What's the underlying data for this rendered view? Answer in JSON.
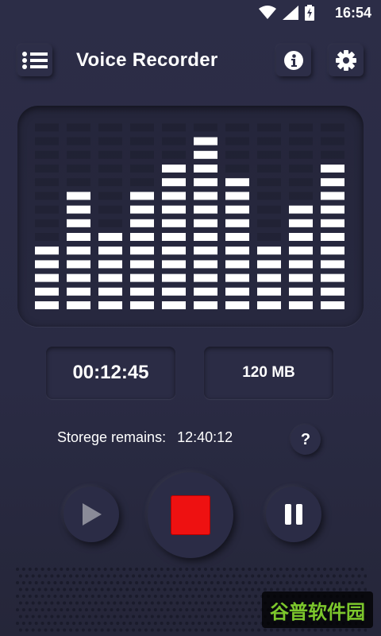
{
  "status_bar": {
    "time": "16:54",
    "icons": [
      "wifi-icon",
      "signal-icon",
      "battery-charging-icon"
    ]
  },
  "app_bar": {
    "title": "Voice Recorder",
    "left_icon": "list-menu-icon",
    "right_icons": [
      "info-icon",
      "gear-icon"
    ]
  },
  "equalizer": {
    "bar_levels": [
      5,
      9,
      6,
      9,
      11,
      13,
      10,
      5,
      8,
      11
    ],
    "max_level": 14,
    "color": "#ffffff"
  },
  "readouts": {
    "elapsed_time": "00:12:45",
    "file_size": "120 MB"
  },
  "storage": {
    "label": "Storege remains:",
    "value": "12:40:12",
    "help_label": "?"
  },
  "controls": {
    "play_icon": "play-icon",
    "stop_icon": "stop-icon",
    "pause_icon": "pause-icon",
    "stop_color": "#ee1111"
  },
  "watermark": {
    "text": "谷普软件园"
  }
}
